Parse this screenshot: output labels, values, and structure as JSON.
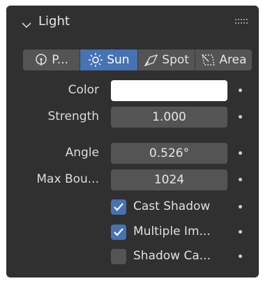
{
  "panel": {
    "title": "Light",
    "expand_icon": "chevron-down-icon",
    "drag_icon": "grip-dots-icon"
  },
  "light_types": [
    {
      "label": "P...",
      "icon": "point-light-icon",
      "active": false
    },
    {
      "label": "Sun",
      "icon": "sun-light-icon",
      "active": true
    },
    {
      "label": "Spot",
      "icon": "spot-light-icon",
      "active": false
    },
    {
      "label": "Area",
      "icon": "area-light-icon",
      "active": false
    }
  ],
  "properties": {
    "color": {
      "label": "Color",
      "value": "#ffffff"
    },
    "strength": {
      "label": "Strength",
      "value": "1.000"
    },
    "angle": {
      "label": "Angle",
      "value": "0.526°"
    },
    "max_bounces": {
      "label": "Max Bou...",
      "value": "1024"
    }
  },
  "checkboxes": {
    "cast_shadow": {
      "label": "Cast Shadow",
      "checked": true
    },
    "multiple_importance": {
      "label": "Multiple Im...",
      "checked": true
    },
    "shadow_caustics": {
      "label": "Shadow Ca...",
      "checked": false
    }
  },
  "colors": {
    "panel_bg": "#303030",
    "field_bg": "#545454",
    "accent": "#4772b3"
  }
}
